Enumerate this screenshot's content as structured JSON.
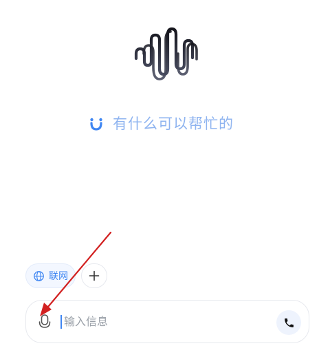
{
  "logo": {
    "icon": "waveform-logo-icon"
  },
  "greeting": {
    "icon": "smile-icon",
    "text": "有什么可以帮忙的",
    "color": "#8fb4f0"
  },
  "chips": {
    "web_search": {
      "label": "联网",
      "icon": "globe-icon",
      "color": "#3f86f2"
    },
    "add": {
      "icon": "plus-icon"
    }
  },
  "input": {
    "placeholder": "输入信息",
    "mic_icon": "microphone-icon",
    "call_icon": "phone-icon"
  },
  "annotation": {
    "icon": "red-arrow",
    "color": "#d22020"
  }
}
